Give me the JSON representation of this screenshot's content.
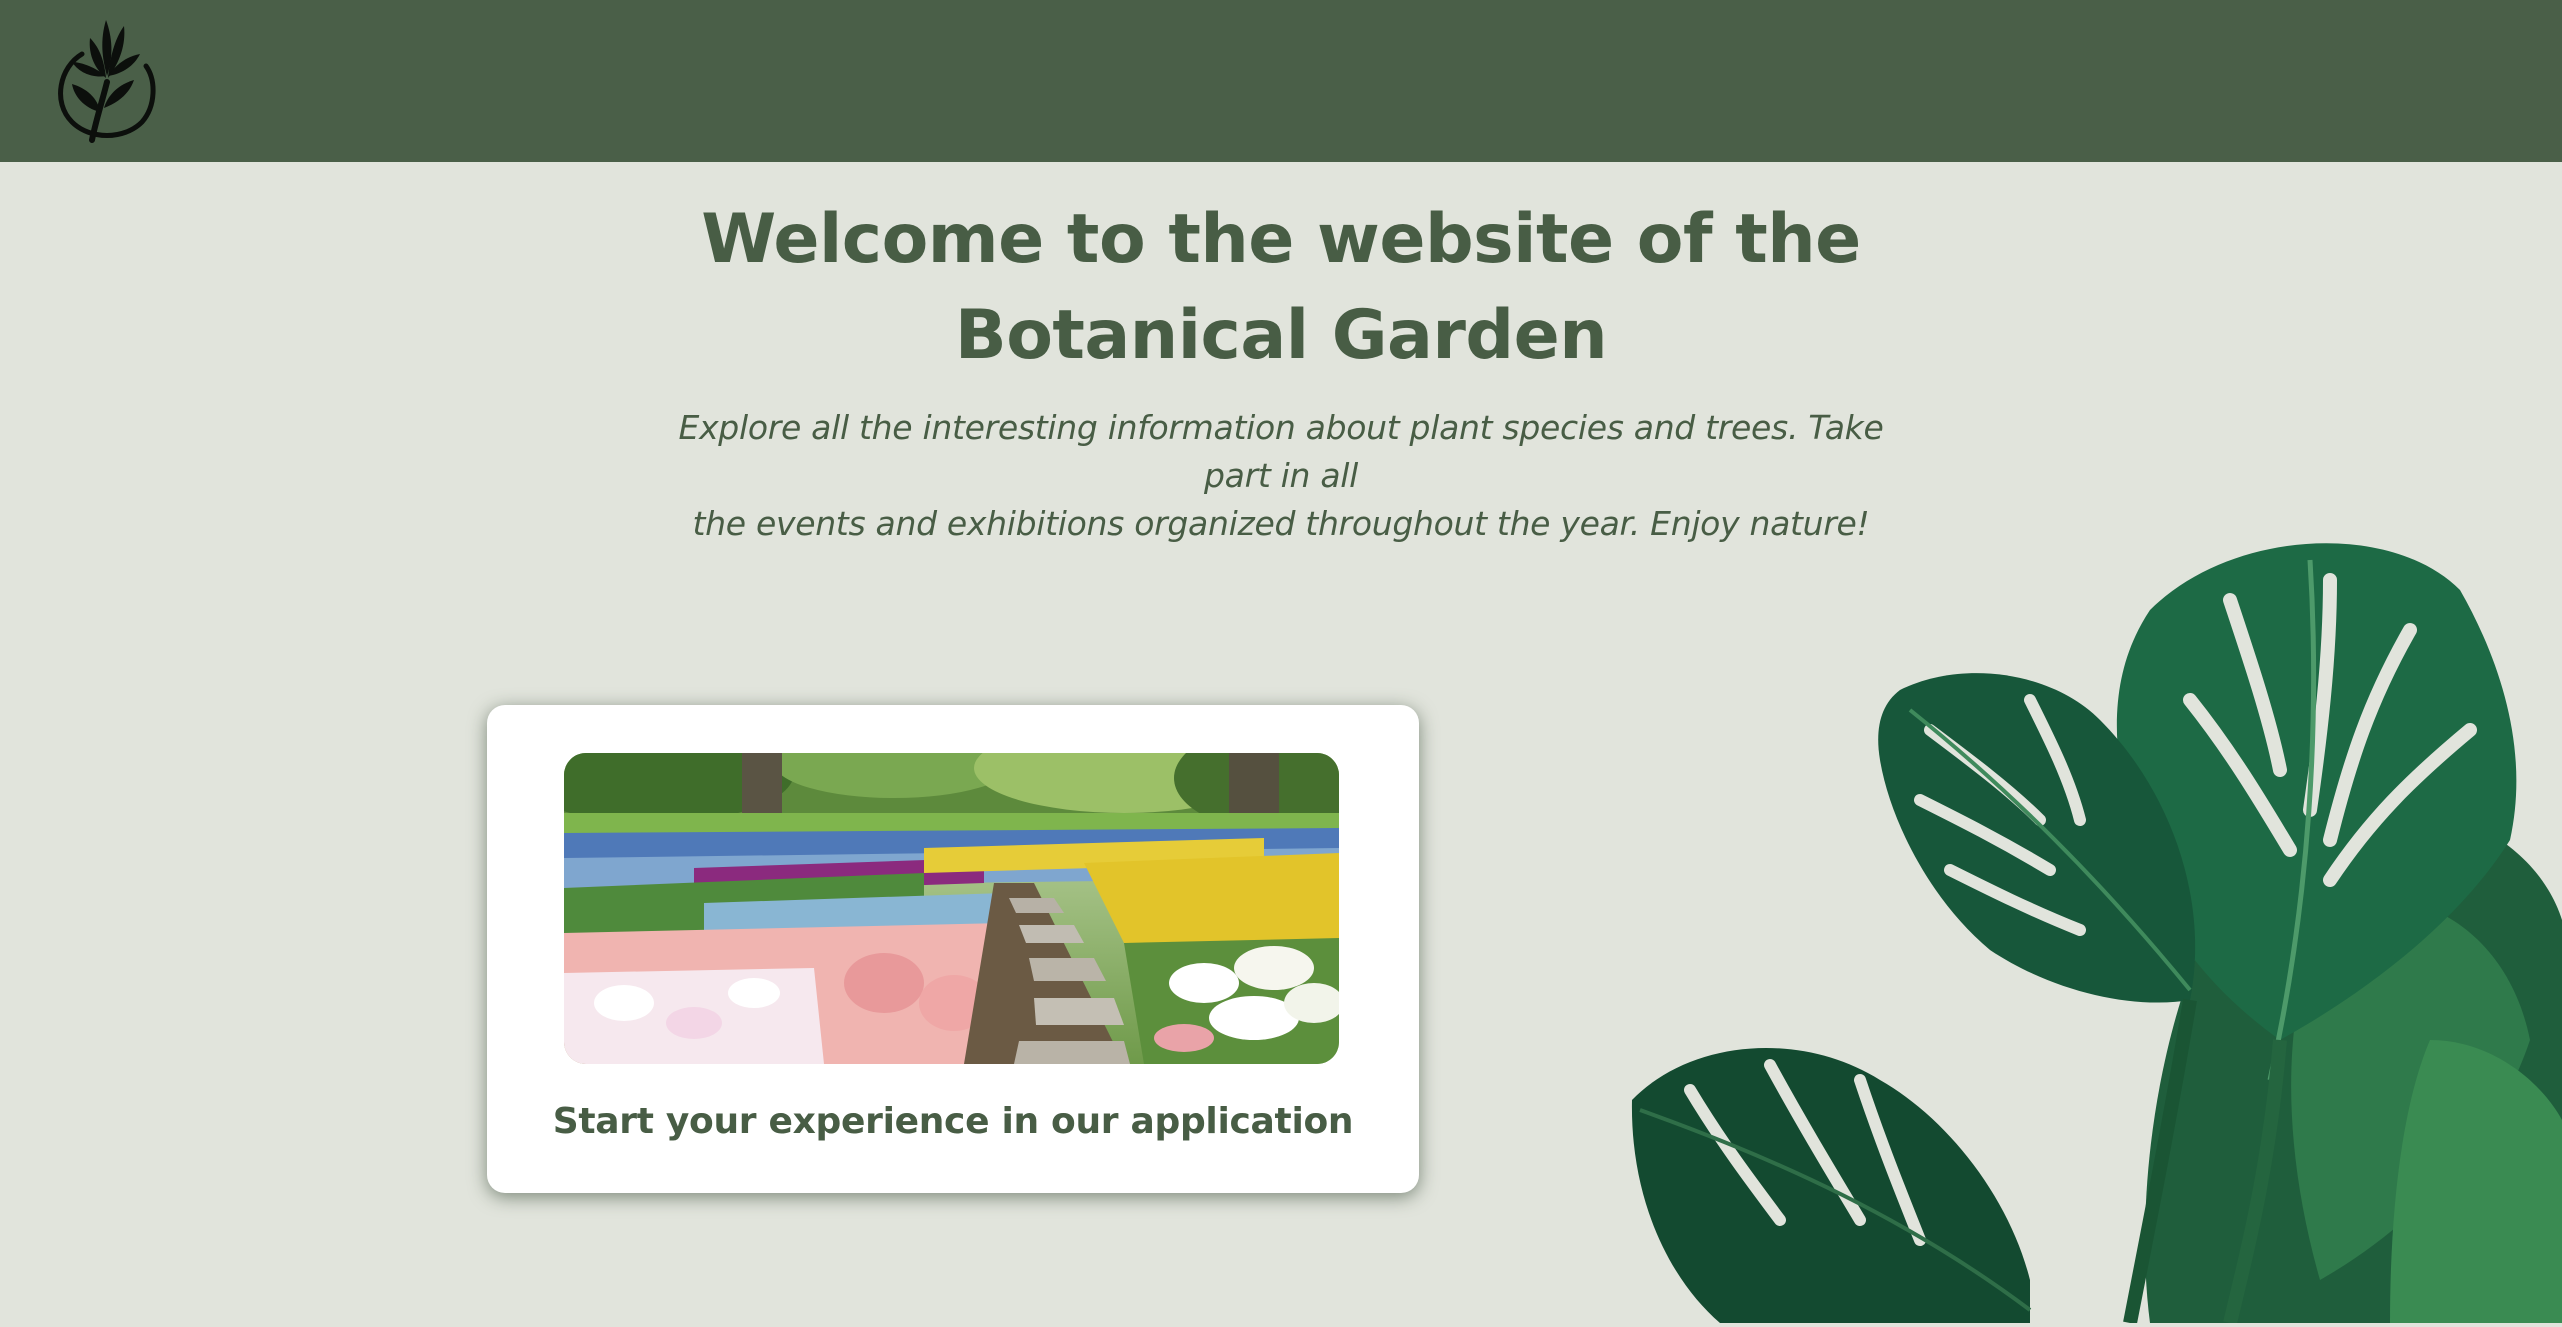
{
  "header": {
    "logo_icon": "lily-flower-logo-icon",
    "background_color": "#4a5f48"
  },
  "hero": {
    "title_line1": "Welcome to the website of the",
    "title_line2": "Botanical Garden",
    "subtitle_line1": "Explore all the interesting information about plant species and trees. Take part in all",
    "subtitle_line2": "the events and exhibitions organized throughout the year. Enjoy nature!",
    "text_color": "#485d45"
  },
  "app_card": {
    "image_description_icon": "garden-flower-path-image",
    "label": "Start your experience in our application"
  },
  "decor": {
    "plant_icon": "monstera-leaves-image"
  },
  "colors": {
    "page_background": "#e1e4dc",
    "card_background": "#ffffff",
    "accent_green": "#485d45"
  }
}
